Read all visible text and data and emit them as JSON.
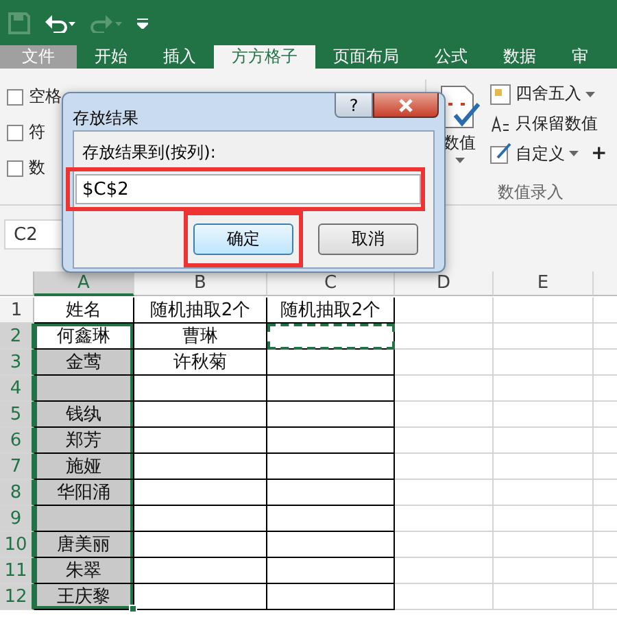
{
  "tabs": [
    {
      "label": "文件",
      "kind": "file",
      "selected": false
    },
    {
      "label": "开始",
      "kind": "tab",
      "selected": false
    },
    {
      "label": "插入",
      "kind": "tab",
      "selected": false
    },
    {
      "label": "方方格子",
      "kind": "tab",
      "selected": true
    },
    {
      "label": "页面布局",
      "kind": "tab",
      "selected": false
    },
    {
      "label": "公式",
      "kind": "tab",
      "selected": false
    },
    {
      "label": "数据",
      "kind": "tab",
      "selected": false
    },
    {
      "label": "审",
      "kind": "tab",
      "selected": false
    }
  ],
  "ribbon": {
    "left_group": {
      "checkboxes": [
        {
          "label": "空格",
          "checked": false
        },
        {
          "label": "符",
          "checked": false
        },
        {
          "label": "数",
          "checked": false
        }
      ]
    },
    "values_group": {
      "big_button": "数值",
      "items": [
        {
          "label": "四舍五入",
          "dropdown": true
        },
        {
          "label": "只保留数值",
          "dropdown": false
        },
        {
          "label": "自定义",
          "dropdown": true
        }
      ],
      "more": "+",
      "label": "数值录入"
    }
  },
  "name_box": "C2",
  "dialog": {
    "title": "存放结果",
    "help": "?",
    "label": "存放结果到(按列):",
    "field": {
      "value": "$C$2",
      "highlighted": true
    },
    "buttons": [
      {
        "label": "确定",
        "default": true,
        "highlighted": true
      },
      {
        "label": "取消",
        "default": false,
        "highlighted": false
      }
    ]
  },
  "sheet": {
    "columns": [
      {
        "label": "A",
        "selected": true
      },
      {
        "label": "B",
        "selected": false
      },
      {
        "label": "C",
        "selected": false
      },
      {
        "label": "D",
        "selected": false
      },
      {
        "label": "E",
        "selected": false
      }
    ],
    "rows": [
      {
        "header": "1",
        "selected": false,
        "cells": [
          {
            "text": "姓名",
            "shaded": false,
            "selected": false
          },
          {
            "text": "随机抽取2个",
            "shaded": false
          },
          {
            "text": "随机抽取2个",
            "shaded": false
          }
        ]
      },
      {
        "header": "2",
        "selected": true,
        "cells": [
          {
            "text": "何鑫琳",
            "shaded": false,
            "selected": true
          },
          {
            "text": "曹琳",
            "shaded": false
          },
          {
            "shaded": false,
            "marquee": true
          }
        ]
      },
      {
        "header": "3",
        "selected": true,
        "cells": [
          {
            "text": "金莺",
            "shaded": true,
            "selected": true
          },
          {
            "text": "许秋菊",
            "shaded": false
          },
          {
            "shaded": false
          }
        ]
      },
      {
        "header": "4",
        "selected": true,
        "cells": [
          {
            "shaded": true,
            "selected": true
          },
          {
            "shaded": false
          },
          {
            "shaded": false
          }
        ]
      },
      {
        "header": "5",
        "selected": true,
        "cells": [
          {
            "text": "钱纨",
            "shaded": true,
            "selected": true
          },
          {
            "shaded": false
          },
          {
            "shaded": false
          }
        ]
      },
      {
        "header": "6",
        "selected": true,
        "cells": [
          {
            "text": "郑芳",
            "shaded": true,
            "selected": true
          },
          {
            "shaded": false
          },
          {
            "shaded": false
          }
        ]
      },
      {
        "header": "7",
        "selected": true,
        "cells": [
          {
            "text": "施娅",
            "shaded": true,
            "selected": true
          },
          {
            "shaded": false
          },
          {
            "shaded": false
          }
        ]
      },
      {
        "header": "8",
        "selected": true,
        "cells": [
          {
            "text": "华阳涌",
            "shaded": true,
            "selected": true
          },
          {
            "shaded": false
          },
          {
            "shaded": false
          }
        ]
      },
      {
        "header": "9",
        "selected": true,
        "cells": [
          {
            "shaded": true,
            "selected": true
          },
          {
            "shaded": false
          },
          {
            "shaded": false
          }
        ]
      },
      {
        "header": "10",
        "selected": true,
        "cells": [
          {
            "text": "唐美丽",
            "shaded": true,
            "selected": true
          },
          {
            "shaded": false
          },
          {
            "shaded": false
          }
        ]
      },
      {
        "header": "11",
        "selected": true,
        "cells": [
          {
            "text": "朱翠",
            "shaded": true,
            "selected": true
          },
          {
            "shaded": false
          },
          {
            "shaded": false
          }
        ]
      },
      {
        "header": "12",
        "selected": true,
        "cells": [
          {
            "text": "王庆黎",
            "shaded": true,
            "selected": true
          },
          {
            "shaded": false
          },
          {
            "shaded": false
          }
        ]
      }
    ]
  }
}
